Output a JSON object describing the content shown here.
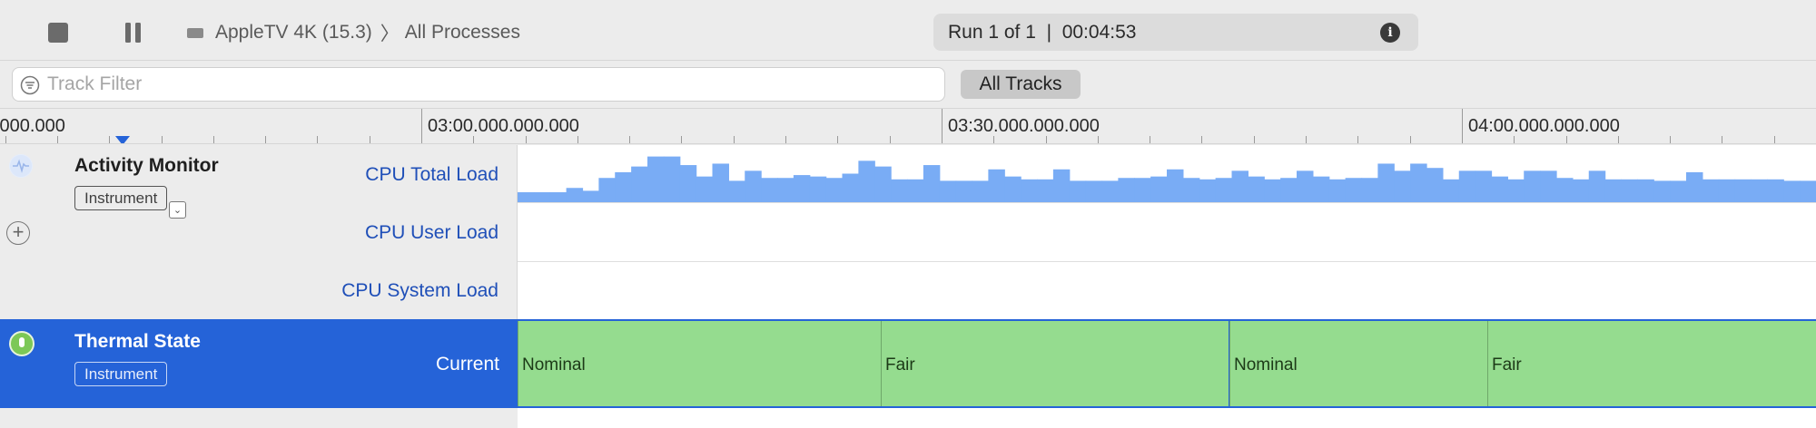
{
  "toolbar": {
    "device": "AppleTV 4K (15.3)",
    "separator": "〉",
    "target": "All Processes",
    "run_status": "Run 1 of 1  |  00:04:53"
  },
  "filter": {
    "placeholder": "Track Filter",
    "all_tracks_label": "All Tracks"
  },
  "ruler": {
    "labels": [
      {
        "text": ".000.000"
      },
      {
        "text": "03:00.000.000.000"
      },
      {
        "text": "03:30.000.000.000"
      },
      {
        "text": "04:00.000.000.000"
      }
    ]
  },
  "instruments": [
    {
      "title": "Activity Monitor",
      "badge": "Instrument",
      "tracks": [
        "CPU Total Load",
        "CPU User Load",
        "CPU System Load"
      ]
    },
    {
      "title": "Thermal State",
      "badge": "Instrument",
      "tracks": [
        "Current"
      ]
    }
  ],
  "cpu_total_load": [
    7,
    7,
    7,
    10,
    8,
    17,
    21,
    25,
    32,
    32,
    26,
    18,
    27,
    15,
    22,
    17,
    17,
    19,
    18,
    17,
    20,
    29,
    25,
    16,
    16,
    26,
    15,
    15,
    15,
    23,
    18,
    16,
    16,
    23,
    15,
    15,
    15,
    17,
    17,
    18,
    23,
    17,
    16,
    17,
    22,
    18,
    16,
    17,
    22,
    18,
    16,
    17,
    17,
    27,
    22,
    27,
    24,
    16,
    22,
    22,
    18,
    16,
    22,
    22,
    17,
    16,
    22,
    16,
    16,
    16,
    15,
    15,
    21,
    16,
    16,
    16,
    16,
    16,
    15,
    15
  ],
  "thermal_states": [
    {
      "label": "Nominal",
      "start": 0.0,
      "end": 0.28
    },
    {
      "label": "Fair",
      "start": 0.28,
      "end": 0.548
    },
    {
      "label": "Nominal",
      "start": 0.548,
      "end": 0.747
    },
    {
      "label": "Fair",
      "start": 0.747,
      "end": 1.0
    }
  ],
  "colors": {
    "accent": "#2563d8",
    "cpu_bar": "#79acf5",
    "thermal_fill": "#95dc8f",
    "track_label": "#1f4fb8"
  }
}
